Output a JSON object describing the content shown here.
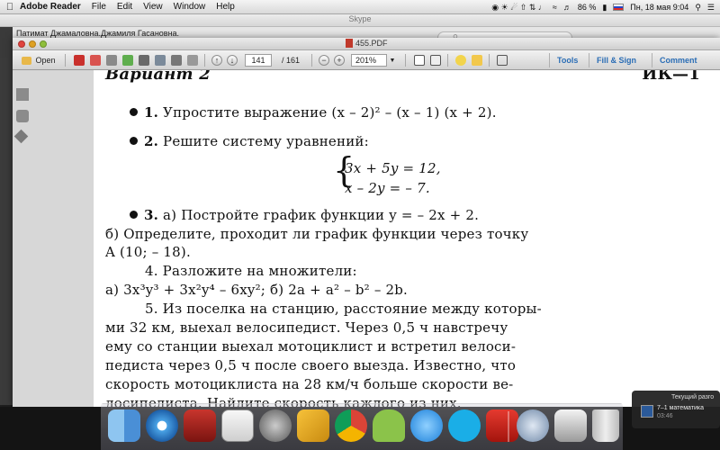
{
  "menubar": {
    "app_name": "Adobe Reader",
    "items": [
      "File",
      "Edit",
      "View",
      "Window",
      "Help"
    ],
    "battery": "86 %",
    "clock": "Пн, 18 мая  9:04"
  },
  "skype": {
    "title": "Skype",
    "caller": "Патимат Джамаловна.Джамиля Гасановна."
  },
  "reader": {
    "doc_title": "455.PDF",
    "toolbar": {
      "open_label": "Open",
      "page_current": "141",
      "page_total": "/ 161",
      "zoom": "201%",
      "links": [
        "Tools",
        "Fill & Sign",
        "Comment"
      ]
    }
  },
  "document": {
    "header_left": "Вариант 2",
    "header_right": "ИК—1",
    "task1_num": "1.",
    "task1_text": "Упростите выражение (x – 2)² – (x – 1) (x + 2).",
    "task2_num": "2.",
    "task2_text": "Решите систему уравнений:",
    "eq1": "3x + 5y = 12,",
    "eq2": "x – 2y = – 7.",
    "task3_num": "3.",
    "task3_text": "а) Постройте график функции y = – 2x + 2.",
    "task3b_line1": "б) Определите, проходит ли график функции через точку",
    "task3b_line2": "A (10; – 18).",
    "task4_title": "4. Разложите на множители:",
    "task4_body": "а) 3x³y³ + 3x²y⁴ – 6xy²;  б) 2a + a² – b² – 2b.",
    "task5_lines": [
      "5. Из поселка на станцию, расстояние между которы-",
      "ми 32 км, выехал велосипедист. Через 0,5 ч навстречу",
      "ему со станции выехал мотоциклист и встретил велоси-",
      "педиста через 0,5 ч после своего выезда. Известно, что",
      "скорость мотоциклиста на 28 км/ч больше скорости ве-",
      "лосипедиста. Найдите скорость каждого из них."
    ]
  },
  "notification": {
    "title": "Текущий разго",
    "item": "7–1 математика",
    "time": "03:46"
  },
  "dock": {
    "apps": [
      "finder-icon",
      "safari-icon",
      "photo-booth-icon",
      "preview-icon",
      "launchpad-icon",
      "pencil-icon",
      "chrome-icon",
      "android-icon",
      "itunes-icon",
      "skype-icon",
      "adobe-reader-icon",
      "utility-icon",
      "printer-icon",
      "trash-icon"
    ]
  }
}
